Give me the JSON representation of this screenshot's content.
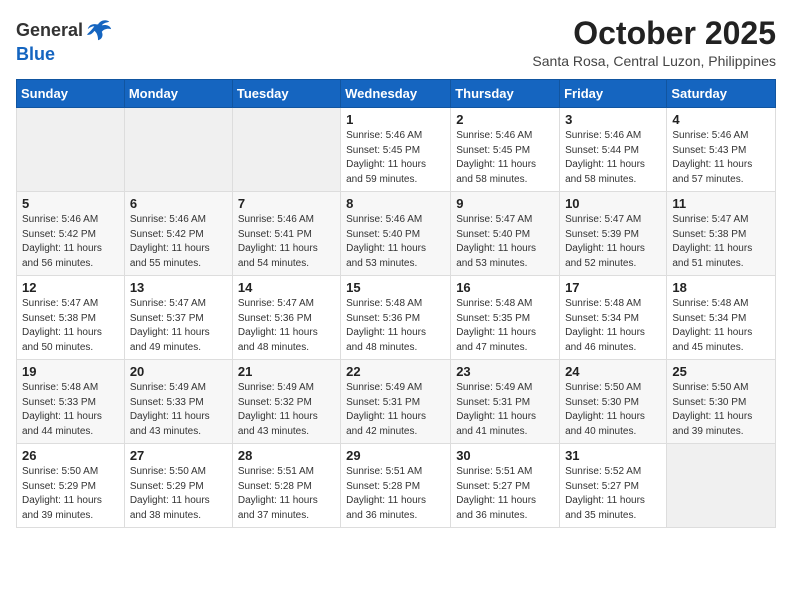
{
  "header": {
    "logo_general": "General",
    "logo_blue": "Blue",
    "month_year": "October 2025",
    "location": "Santa Rosa, Central Luzon, Philippines"
  },
  "weekdays": [
    "Sunday",
    "Monday",
    "Tuesday",
    "Wednesday",
    "Thursday",
    "Friday",
    "Saturday"
  ],
  "weeks": [
    [
      {
        "day": "",
        "info": ""
      },
      {
        "day": "",
        "info": ""
      },
      {
        "day": "",
        "info": ""
      },
      {
        "day": "1",
        "info": "Sunrise: 5:46 AM\nSunset: 5:45 PM\nDaylight: 11 hours\nand 59 minutes."
      },
      {
        "day": "2",
        "info": "Sunrise: 5:46 AM\nSunset: 5:45 PM\nDaylight: 11 hours\nand 58 minutes."
      },
      {
        "day": "3",
        "info": "Sunrise: 5:46 AM\nSunset: 5:44 PM\nDaylight: 11 hours\nand 58 minutes."
      },
      {
        "day": "4",
        "info": "Sunrise: 5:46 AM\nSunset: 5:43 PM\nDaylight: 11 hours\nand 57 minutes."
      }
    ],
    [
      {
        "day": "5",
        "info": "Sunrise: 5:46 AM\nSunset: 5:42 PM\nDaylight: 11 hours\nand 56 minutes."
      },
      {
        "day": "6",
        "info": "Sunrise: 5:46 AM\nSunset: 5:42 PM\nDaylight: 11 hours\nand 55 minutes."
      },
      {
        "day": "7",
        "info": "Sunrise: 5:46 AM\nSunset: 5:41 PM\nDaylight: 11 hours\nand 54 minutes."
      },
      {
        "day": "8",
        "info": "Sunrise: 5:46 AM\nSunset: 5:40 PM\nDaylight: 11 hours\nand 53 minutes."
      },
      {
        "day": "9",
        "info": "Sunrise: 5:47 AM\nSunset: 5:40 PM\nDaylight: 11 hours\nand 53 minutes."
      },
      {
        "day": "10",
        "info": "Sunrise: 5:47 AM\nSunset: 5:39 PM\nDaylight: 11 hours\nand 52 minutes."
      },
      {
        "day": "11",
        "info": "Sunrise: 5:47 AM\nSunset: 5:38 PM\nDaylight: 11 hours\nand 51 minutes."
      }
    ],
    [
      {
        "day": "12",
        "info": "Sunrise: 5:47 AM\nSunset: 5:38 PM\nDaylight: 11 hours\nand 50 minutes."
      },
      {
        "day": "13",
        "info": "Sunrise: 5:47 AM\nSunset: 5:37 PM\nDaylight: 11 hours\nand 49 minutes."
      },
      {
        "day": "14",
        "info": "Sunrise: 5:47 AM\nSunset: 5:36 PM\nDaylight: 11 hours\nand 48 minutes."
      },
      {
        "day": "15",
        "info": "Sunrise: 5:48 AM\nSunset: 5:36 PM\nDaylight: 11 hours\nand 48 minutes."
      },
      {
        "day": "16",
        "info": "Sunrise: 5:48 AM\nSunset: 5:35 PM\nDaylight: 11 hours\nand 47 minutes."
      },
      {
        "day": "17",
        "info": "Sunrise: 5:48 AM\nSunset: 5:34 PM\nDaylight: 11 hours\nand 46 minutes."
      },
      {
        "day": "18",
        "info": "Sunrise: 5:48 AM\nSunset: 5:34 PM\nDaylight: 11 hours\nand 45 minutes."
      }
    ],
    [
      {
        "day": "19",
        "info": "Sunrise: 5:48 AM\nSunset: 5:33 PM\nDaylight: 11 hours\nand 44 minutes."
      },
      {
        "day": "20",
        "info": "Sunrise: 5:49 AM\nSunset: 5:33 PM\nDaylight: 11 hours\nand 43 minutes."
      },
      {
        "day": "21",
        "info": "Sunrise: 5:49 AM\nSunset: 5:32 PM\nDaylight: 11 hours\nand 43 minutes."
      },
      {
        "day": "22",
        "info": "Sunrise: 5:49 AM\nSunset: 5:31 PM\nDaylight: 11 hours\nand 42 minutes."
      },
      {
        "day": "23",
        "info": "Sunrise: 5:49 AM\nSunset: 5:31 PM\nDaylight: 11 hours\nand 41 minutes."
      },
      {
        "day": "24",
        "info": "Sunrise: 5:50 AM\nSunset: 5:30 PM\nDaylight: 11 hours\nand 40 minutes."
      },
      {
        "day": "25",
        "info": "Sunrise: 5:50 AM\nSunset: 5:30 PM\nDaylight: 11 hours\nand 39 minutes."
      }
    ],
    [
      {
        "day": "26",
        "info": "Sunrise: 5:50 AM\nSunset: 5:29 PM\nDaylight: 11 hours\nand 39 minutes."
      },
      {
        "day": "27",
        "info": "Sunrise: 5:50 AM\nSunset: 5:29 PM\nDaylight: 11 hours\nand 38 minutes."
      },
      {
        "day": "28",
        "info": "Sunrise: 5:51 AM\nSunset: 5:28 PM\nDaylight: 11 hours\nand 37 minutes."
      },
      {
        "day": "29",
        "info": "Sunrise: 5:51 AM\nSunset: 5:28 PM\nDaylight: 11 hours\nand 36 minutes."
      },
      {
        "day": "30",
        "info": "Sunrise: 5:51 AM\nSunset: 5:27 PM\nDaylight: 11 hours\nand 36 minutes."
      },
      {
        "day": "31",
        "info": "Sunrise: 5:52 AM\nSunset: 5:27 PM\nDaylight: 11 hours\nand 35 minutes."
      },
      {
        "day": "",
        "info": ""
      }
    ]
  ]
}
